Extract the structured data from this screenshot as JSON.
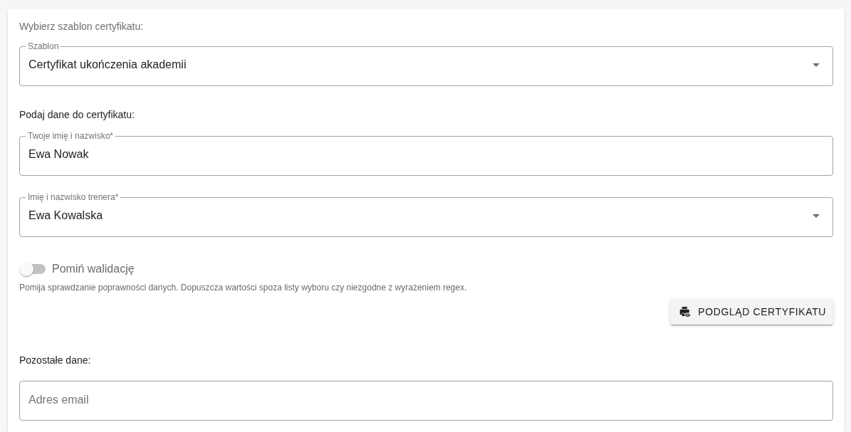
{
  "template_section": {
    "heading": "Wybierz szablon certyfikatu:",
    "fields": [
      {
        "kind": "select",
        "label": "Szablon",
        "value": "Certyfikat ukończenia akademii"
      }
    ]
  },
  "data_section": {
    "heading": "Podaj dane do certyfikatu:",
    "fields": [
      {
        "kind": "text",
        "label": "Twoje imię i nazwisko*",
        "value": "Ewa Nowak"
      },
      {
        "kind": "select",
        "label": "Imię i nazwisko trenera*",
        "value": "Ewa Kowalska"
      }
    ]
  },
  "skip_validation": {
    "label": "Pomiń walidację",
    "on": false,
    "helper": "Pomija sprawdzanie poprawności danych. Dopuszcza wartości spoza listy wyboru czy niezgodne z wyrażeniem regex."
  },
  "preview_button": {
    "label": "PODGLĄD CERTYFIKATU"
  },
  "other_section": {
    "heading": "Pozostałe dane:",
    "fields": [
      {
        "kind": "text",
        "placeholder": "Adres email"
      }
    ]
  }
}
